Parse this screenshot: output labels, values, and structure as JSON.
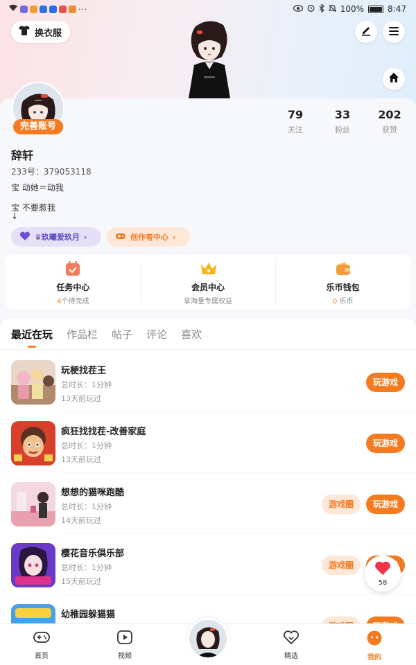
{
  "status_bar": {
    "battery": "100%",
    "time": "8:47"
  },
  "header": {
    "outfit_label": "换衣服"
  },
  "profile": {
    "complete_label": "完善账号",
    "username": "辞轩",
    "uid": "233号：379053118",
    "bio_lines": [
      "宝  动她＝动我",
      "宝  不要惹我",
      "↓"
    ],
    "stats": [
      {
        "value": "79",
        "label": "关注"
      },
      {
        "value": "33",
        "label": "粉丝"
      },
      {
        "value": "202",
        "label": "获赞"
      }
    ],
    "tags": [
      {
        "label": "♛玖曦爱玖月"
      },
      {
        "label": "创作者中心"
      }
    ]
  },
  "services": [
    {
      "title": "任务中心",
      "highlight": "4",
      "sub": "个待完成"
    },
    {
      "title": "会员中心",
      "highlight": "",
      "sub": "享海量专属权益"
    },
    {
      "title": "乐币钱包",
      "highlight": "0",
      "sub": " 乐币"
    }
  ],
  "tabs": [
    "最近在玩",
    "作品栏",
    "帖子",
    "评论",
    "喜欢"
  ],
  "games": [
    {
      "name": "玩梗找茬王",
      "duration": "总时长：1分钟",
      "last_played": "13天前玩过",
      "show_circle": false
    },
    {
      "name": "疯狂找找茬-改善家庭",
      "duration": "总时长：1分钟",
      "last_played": "13天前玩过",
      "show_circle": false
    },
    {
      "name": "想想的猫咪跑酷",
      "duration": "总时长：1分钟",
      "last_played": "14天前玩过",
      "show_circle": true
    },
    {
      "name": "樱花音乐俱乐部",
      "duration": "总时长：1分钟",
      "last_played": "15天前玩过",
      "show_circle": true
    },
    {
      "name": "幼稚园躲猫猫",
      "duration": "",
      "last_played": "",
      "show_circle": true
    }
  ],
  "buttons": {
    "play": "玩游戏",
    "circle": "游戏圈"
  },
  "float_like": {
    "count": "58"
  },
  "bottom_nav": [
    {
      "label": "首页"
    },
    {
      "label": "视频"
    },
    {
      "label": "精选"
    },
    {
      "label": "我的"
    }
  ],
  "colors": {
    "accent": "#f47b20",
    "accent_light": "#fde7d8",
    "purple": "#6a4fd1"
  }
}
